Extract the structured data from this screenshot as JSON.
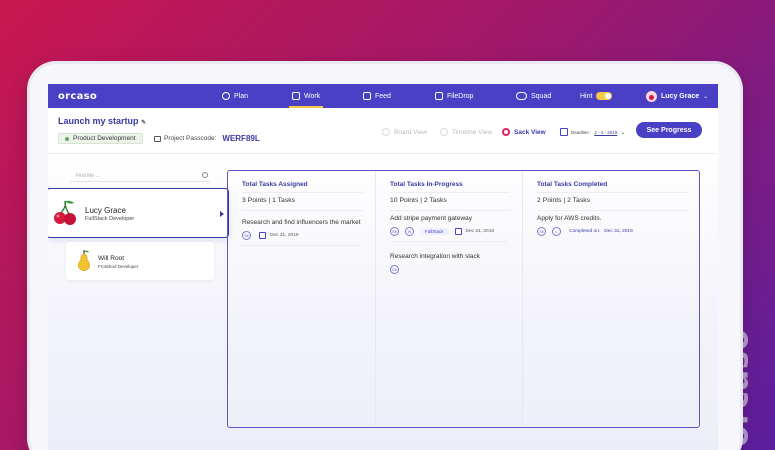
{
  "brand": {
    "side_logo": "orcaso"
  },
  "nav": {
    "logo": "orcaso",
    "items": [
      {
        "label": "Plan",
        "icon": "plan-icon"
      },
      {
        "label": "Work",
        "icon": "work-icon",
        "active": true
      },
      {
        "label": "Feed",
        "icon": "feed-icon"
      },
      {
        "label": "FileDrop",
        "icon": "filedrop-icon"
      },
      {
        "label": "Squad",
        "icon": "squad-icon"
      }
    ],
    "hint_label": "Hint",
    "user_name": "Lucy Grace",
    "accent": "#4a40c6",
    "highlight": "#f7c948"
  },
  "header": {
    "project_title": "Launch my startup",
    "tag": "Product Development",
    "passcode_label": "Project Passcode:",
    "passcode_value": "WERF89L",
    "views": [
      {
        "label": "Board View",
        "selected": false
      },
      {
        "label": "Timeline View",
        "selected": false
      },
      {
        "label": "Sack View",
        "selected": true
      }
    ],
    "deadline_label": "Deadline :",
    "deadline_value": "2 - 4 - 2019",
    "progress_button": "See Progress"
  },
  "sidebar": {
    "search_placeholder": "Find Me ...",
    "members": [
      {
        "name": "Lucy Grace",
        "role": "FullStack Developer",
        "avatar": "cherry-icon"
      },
      {
        "name": "Will Root",
        "role": "FrontEnd Developer",
        "avatar": "pear-icon"
      }
    ]
  },
  "board": {
    "columns": [
      {
        "title": "Total Tasks Assigned",
        "points": "3 Points",
        "tasks": "1 Tasks",
        "items": [
          {
            "title": "Research and find influencers the market",
            "avatar": "Sb",
            "date": "Dec 31, 2019"
          }
        ]
      },
      {
        "title": "Total Tasks In-Progress",
        "points": "10 Points",
        "tasks": "2 Tasks",
        "items": [
          {
            "title": "Add stripe payment gateway",
            "avatar": "Rb",
            "avatar2": "W",
            "tag": "FullStack",
            "date": "Dec 31, 2019"
          },
          {
            "title": "Research integration with slack",
            "avatar": "Gb"
          }
        ]
      },
      {
        "title": "Total Tasks Completed",
        "points": "2 Points",
        "tasks": "2 Tasks",
        "items": [
          {
            "title": "Apply for AWS credits.",
            "avatar": "Sb",
            "avatar2": "L",
            "completed_label": "Completed on:",
            "date": "Dec 31, 2019"
          }
        ]
      }
    ]
  }
}
